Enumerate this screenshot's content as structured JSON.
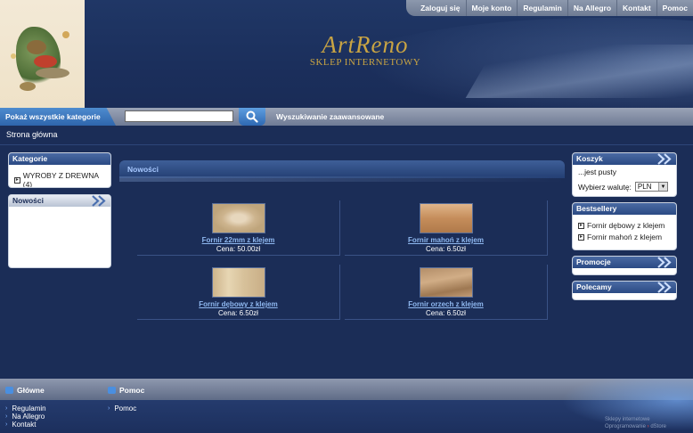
{
  "topnav": {
    "items": [
      "Zaloguj się",
      "Moje konto",
      "Regulamin",
      "Na Allegro",
      "Kontakt",
      "Pomoc"
    ]
  },
  "brand": {
    "name": "ArtReno",
    "tagline": "SKLEP INTERNETOWY"
  },
  "searchbar": {
    "categories_label": "Pokaż wszystkie kategorie",
    "search_value": "",
    "advanced_label": "Wyszukiwanie zaawansowane"
  },
  "breadcrumb": "Strona główna",
  "left": {
    "categories": {
      "title": "Kategorie",
      "items": [
        "WYROBY Z DREWNA (4)"
      ]
    },
    "news": {
      "title": "Nowości"
    }
  },
  "center": {
    "title": "Nowości",
    "products": [
      {
        "name": "Fornir 22mm z klejem",
        "price": "Cena: 50.00zł"
      },
      {
        "name": "Fornir mahoń z klejem",
        "price": "Cena: 6.50zł"
      },
      {
        "name": "Fornir dębowy z klejem",
        "price": "Cena: 6.50zł"
      },
      {
        "name": "Fornir orzech z klejem",
        "price": "Cena: 6.50zł"
      }
    ]
  },
  "right": {
    "cart": {
      "title": "Koszyk",
      "status": "...jest pusty",
      "currency_label": "Wybierz walutę:",
      "currency_value": "PLN"
    },
    "bestsellers": {
      "title": "Bestsellery",
      "items": [
        "Fornir dębowy z klejem",
        "Fornir mahoń z klejem"
      ]
    },
    "promotions": {
      "title": "Promocje"
    },
    "recommended": {
      "title": "Polecamy"
    }
  },
  "footer": {
    "main": {
      "title": "Główne",
      "links": [
        "Regulamin",
        "Na Allegro",
        "Kontakt"
      ]
    },
    "help": {
      "title": "Pomoc",
      "links": [
        "Pomoc"
      ]
    },
    "credit_line1": "Sklepy internetowe",
    "credit_line2a": "Oprogramowanie",
    "credit_line2b": "dStore"
  },
  "colors": {
    "background": "#1b2d57",
    "brand_gold": "#c9a443",
    "link_blue": "#8fb8f0"
  }
}
